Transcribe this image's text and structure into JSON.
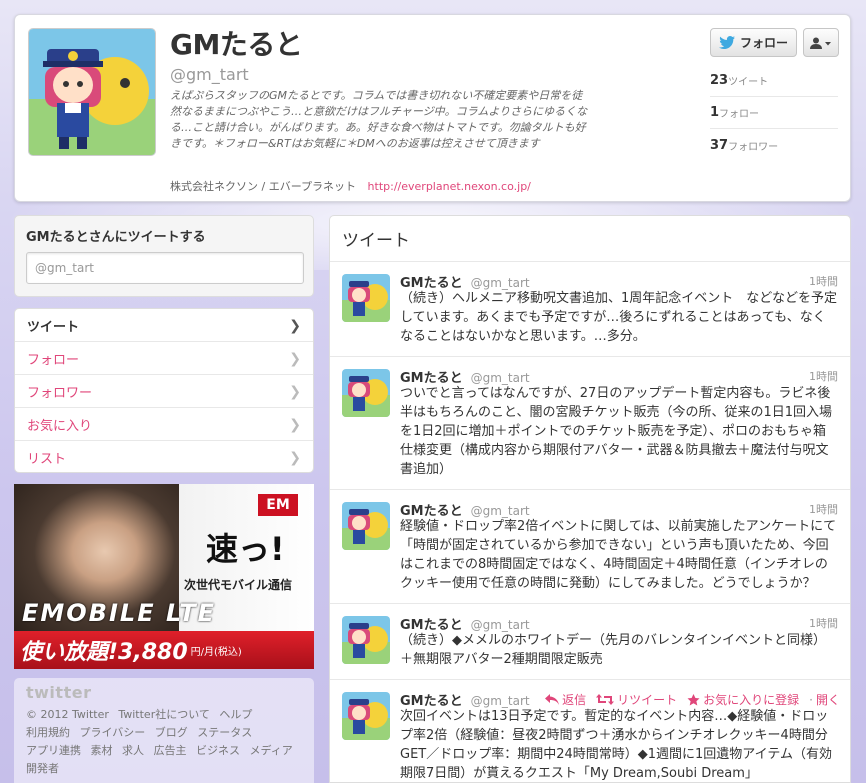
{
  "profile": {
    "name": "GMたると",
    "handle": "@gm_tart",
    "bio": "えばぷらスタッフのGMたるとです。コラムでは書き切れない不確定要素や日常を徒然なるままにつぶやこう…と意欲だけはフルチャージ中。コラムよりさらにゆるくなる…こと請け合い。がんばります。あ。好きな食べ物はトマトです。勿論タルトも好きです。＊フォロー&RTはお気軽に＊DMへのお返事は控えさせて頂きます",
    "location": "株式会社ネクソン / エバープラネット",
    "url": "http://everplanet.nexon.co.jp/",
    "follow_label": "フォロー",
    "stats": [
      {
        "count": "23",
        "label": "ツイート"
      },
      {
        "count": "1",
        "label": "フォロー"
      },
      {
        "count": "37",
        "label": "フォロワー"
      }
    ]
  },
  "tweetbox": {
    "title": "GMたるとさんにツイートする",
    "placeholder": "@gm_tart"
  },
  "nav": {
    "items": [
      {
        "label": "ツイート"
      },
      {
        "label": "フォロー"
      },
      {
        "label": "フォロワー"
      },
      {
        "label": "お気に入り"
      },
      {
        "label": "リスト"
      }
    ]
  },
  "ad": {
    "logo": "EM",
    "headline": "速っ!",
    "sub": "次世代モバイル通信",
    "brand": "EMOBILE LTE",
    "price_main": "使い放題!3,880",
    "price_unit": "円/月(税込)"
  },
  "footer": {
    "logo": "twitter",
    "links": [
      "© 2012 Twitter",
      "Twitter社について",
      "ヘルプ",
      "利用規約",
      "プライバシー",
      "ブログ",
      "ステータス",
      "アプリ連携",
      "素材",
      "求人",
      "広告主",
      "ビジネス",
      "メディア",
      "開発者"
    ]
  },
  "stream": {
    "title": "ツイート",
    "tweets": [
      {
        "name": "GMたると",
        "handle": "@gm_tart",
        "time": "1時間",
        "text": "（続き）ヘルメニア移動呪文書追加、1周年記念イベント　などなどを予定しています。あくまでも予定ですが…後ろにずれることはあっても、なくなることはないかなと思います。…多分。"
      },
      {
        "name": "GMたると",
        "handle": "@gm_tart",
        "time": "1時間",
        "text": "ついでと言ってはなんですが、27日のアップデート暫定内容も。ラビネ後半はもちろんのこと、闇の宮殿チケット販売（今の所、従来の1日1回入場を1日2回に増加＋ポイントでのチケット販売を予定）、ポロのおもちゃ箱仕様変更（構成内容から期限付アバター・武器＆防具撤去＋魔法付与呪文書追加）"
      },
      {
        "name": "GMたると",
        "handle": "@gm_tart",
        "time": "1時間",
        "text": "経験値・ドロップ率2倍イベントに関しては、以前実施したアンケートにて「時間が固定されているから参加できない」という声も頂いたため、今回はこれまでの8時間固定ではなく、4時間固定＋4時間任意（インチオレのクッキー使用で任意の時間に発動）にしてみました。どうでしょうか？"
      },
      {
        "name": "GMたると",
        "handle": "@gm_tart",
        "time": "1時間",
        "text": "（続き）◆メメルのホワイトデー（先月のバレンタインイベントと同様）＋無期限アバター2種期間限定販売"
      },
      {
        "name": "GMたると",
        "handle": "@gm_tart",
        "time": "",
        "text": "次回イベントは13日予定です。暫定的なイベント内容…◆経験値・ドロップ率2倍（経験値：昼夜2時間ずつ＋湧水からインチオレクッキー4時間分GET／ドロップ率：期間中24時間常時）◆1週間に1回遺物アイテム（有効期限7日間）が貰えるクエスト「My Dream,Soubi Dream」"
      }
    ],
    "actions": {
      "reply": "返信",
      "retweet": "リツイート",
      "favorite": "お気に入りに登録",
      "open": "開く"
    }
  },
  "colors": {
    "accent": "#e0467a",
    "text": "#333333",
    "muted": "#999999"
  }
}
